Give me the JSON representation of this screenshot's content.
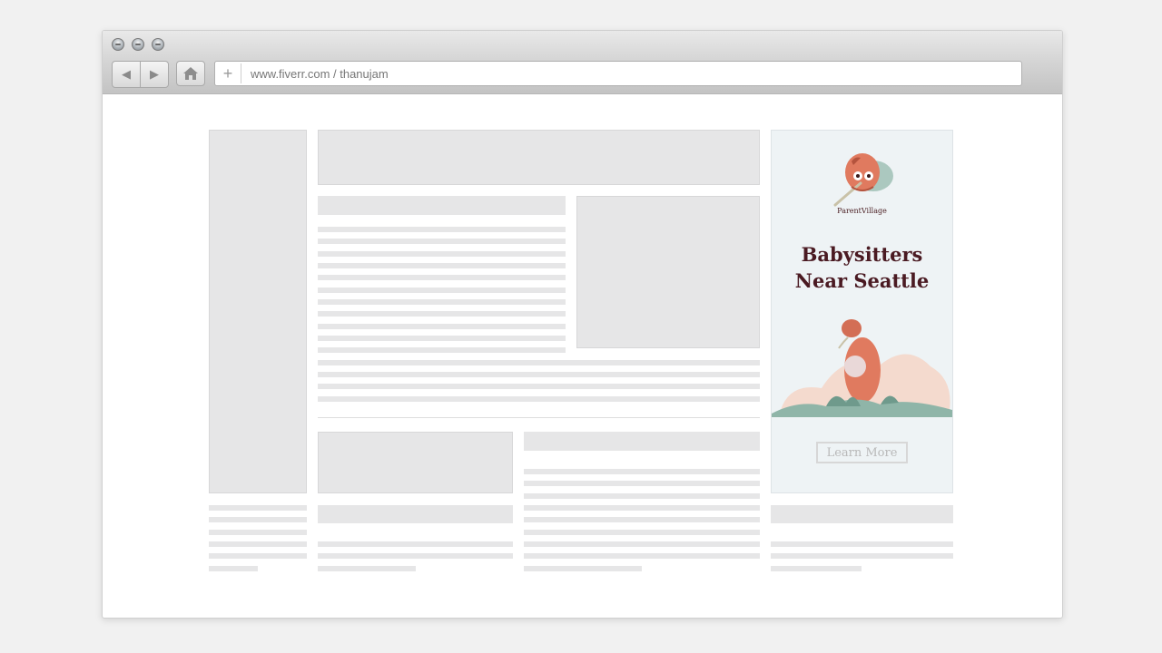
{
  "browser": {
    "url": "www.fiverr.com / thanujam",
    "new_tab_symbol": "+",
    "back_symbol": "◀",
    "forward_symbol": "▶"
  },
  "ad": {
    "brand": "ParentVillage",
    "headline_line1": "Babysitters",
    "headline_line2": "Near Seattle",
    "cta": "Learn More",
    "colors": {
      "headline": "#4a1a22",
      "mascot": "#e07a5f",
      "foliage": "#8fb5a8"
    }
  }
}
